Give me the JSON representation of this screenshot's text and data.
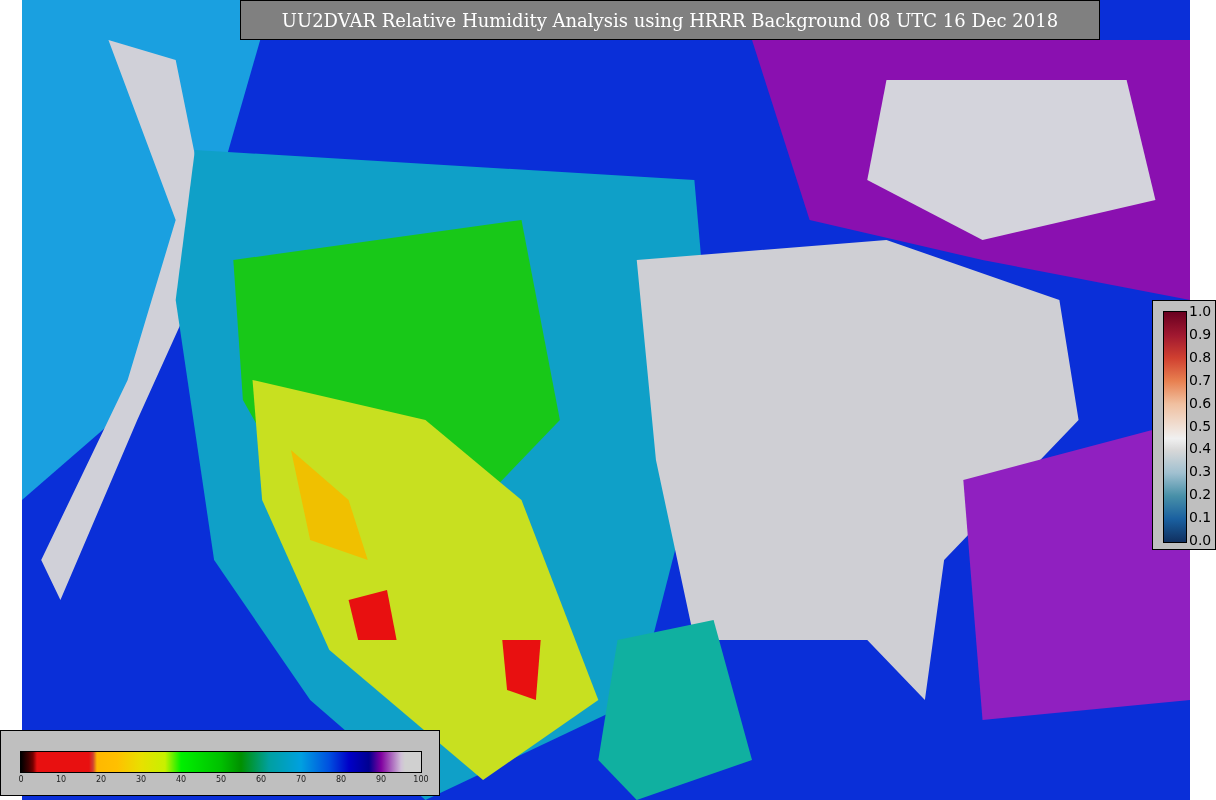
{
  "title": "UU2DVAR Relative Humidity Analysis using HRRR Background 08 UTC 16 Dec 2018",
  "humidity_colorbar": {
    "ticks": [
      "0",
      "10",
      "20",
      "30",
      "40",
      "50",
      "60",
      "70",
      "80",
      "90",
      "100"
    ]
  },
  "ratio_colorbar": {
    "ticks": [
      "1.0",
      "0.9",
      "0.8",
      "0.7",
      "0.6",
      "0.5",
      "0.4",
      "0.3",
      "0.2",
      "0.1",
      "0.0"
    ]
  }
}
